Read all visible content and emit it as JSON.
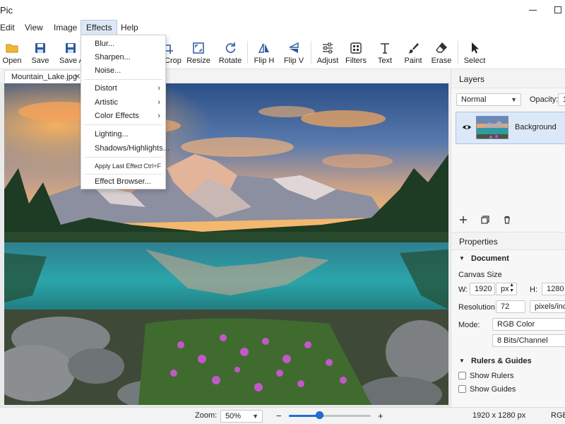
{
  "app": {
    "title": "Pic"
  },
  "menubar": {
    "items": [
      "Edit",
      "View",
      "Image",
      "Effects",
      "Help"
    ],
    "active": "Effects"
  },
  "toolbar": {
    "tools": [
      {
        "label": "Open",
        "icon": "folder-icon"
      },
      {
        "label": "Save",
        "icon": "save-icon"
      },
      {
        "label": "Save As",
        "icon": "save-as-icon"
      },
      {
        "label": "Crop",
        "icon": "crop-icon"
      },
      {
        "label": "Resize",
        "icon": "resize-icon"
      },
      {
        "label": "Rotate",
        "icon": "rotate-icon"
      },
      {
        "label": "Flip H",
        "icon": "flip-horizontal-icon"
      },
      {
        "label": "Flip V",
        "icon": "flip-vertical-icon"
      },
      {
        "label": "Adjust",
        "icon": "sliders-icon"
      },
      {
        "label": "Filters",
        "icon": "filters-icon"
      },
      {
        "label": "Text",
        "icon": "text-icon"
      },
      {
        "label": "Paint",
        "icon": "brush-icon"
      },
      {
        "label": "Erase",
        "icon": "eraser-icon"
      },
      {
        "label": "Select",
        "icon": "cursor-arrow-icon"
      }
    ]
  },
  "effects_menu": {
    "items": [
      {
        "label": "Blur..."
      },
      {
        "label": "Sharpen..."
      },
      {
        "label": "Noise..."
      },
      {
        "label": "Distort",
        "submenu": true
      },
      {
        "label": "Artistic",
        "submenu": true
      },
      {
        "label": "Color Effects",
        "submenu": true
      },
      {
        "label": "Lighting..."
      },
      {
        "label": "Shadows/Highlights..."
      },
      {
        "label": "Apply Last Effect",
        "shortcut": "Ctrl+F"
      },
      {
        "label": "Effect Browser..."
      }
    ]
  },
  "document": {
    "tab_name": "Mountain_Lake.jpg",
    "close_glyph": "✕"
  },
  "layers": {
    "title": "Layers",
    "blend_mode": "Normal",
    "opacity_label": "Opacity:",
    "opacity_value": "1",
    "items": [
      {
        "name": "Background",
        "visible": true
      }
    ]
  },
  "properties": {
    "title": "Properties",
    "document_section": "Document",
    "canvas_size_label": "Canvas Size",
    "width_label": "W:",
    "width_value": "1920",
    "width_unit": "px",
    "height_label": "H:",
    "height_value": "1280",
    "resolution_label": "Resolution:",
    "resolution_value": "72",
    "resolution_unit": "pixels/inch",
    "mode_label": "Mode:",
    "mode_value": "RGB Color",
    "bit_depth": "8 Bits/Channel",
    "rulers_section": "Rulers & Guides",
    "show_rulers": "Show Rulers",
    "show_guides": "Show Guides",
    "show_rulers_checked": false,
    "show_guides_checked": false
  },
  "status": {
    "zoom_label": "Zoom:",
    "zoom_value": "50%",
    "zoom_minus": "−",
    "zoom_plus": "+",
    "zoom_slider_fraction": 0.38,
    "dimensions": "1920 x 1280 px",
    "color_mode": "RGB,"
  },
  "colors": {
    "accent": "#1e6fd9",
    "selection": "#dce8f7"
  }
}
